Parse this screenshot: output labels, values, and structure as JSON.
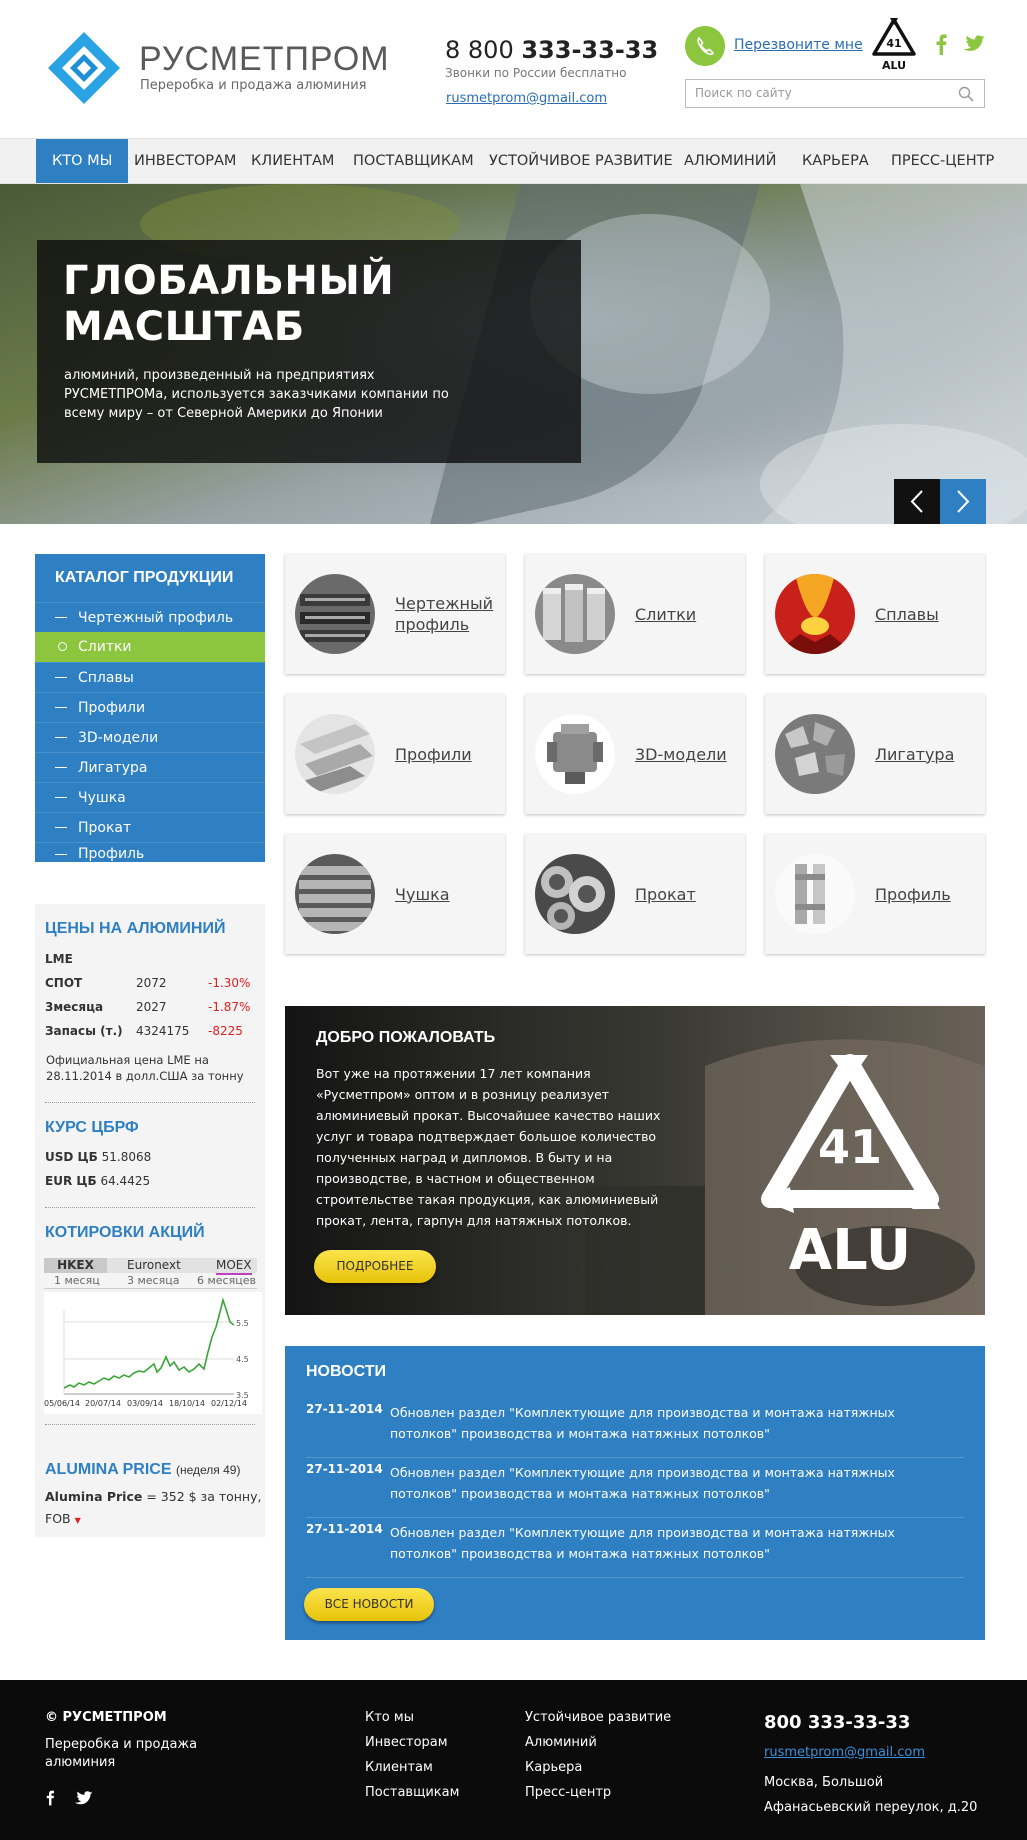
{
  "header": {
    "logo_title": "РУСМЕТПРОМ",
    "logo_subtitle": "Переробка и продажа алюминия",
    "phone_prefix": "8 800",
    "phone_main": "333-33-33",
    "phone_note": "Звонки по России бесплатно",
    "email": "rusmetprom@gmail.com",
    "callback_label": "Перезвоните мне",
    "recycle_number": "41",
    "recycle_label": "ALU",
    "search_placeholder": "Поиск по сайту"
  },
  "nav": {
    "items": [
      "КТО МЫ",
      "ИНВЕСТОРАМ",
      "КЛИЕНТАМ",
      "ПОСТАВЩИКАМ",
      "УСТОЙЧИВОЕ РАЗВИТИЕ",
      "АЛЮМИНИЙ",
      "КАРЬЕРА",
      "ПРЕСС-ЦЕНТР"
    ]
  },
  "hero": {
    "title": "ГЛОБАЛЬНЫЙ МАСШТАБ",
    "text": "алюминий, произведенный на предприятиях РУСМЕТПРОМа, используется заказчиками компании по всему миру – от Северной Америки до Японии"
  },
  "catalog": {
    "title": "КАТАЛОГ ПРОДУКЦИИ",
    "items": [
      "Чертежный профиль",
      "Слитки",
      "Сплавы",
      "Профили",
      "3D-модели",
      "Лигатура",
      "Чушка",
      "Прокат",
      "Профиль"
    ],
    "active_index": 1
  },
  "prices": {
    "title": "ЦЕНЫ НА АЛЮМИНИЙ",
    "lme": "LME",
    "rows": [
      {
        "label": "СПОТ",
        "value": "2072",
        "change": "-1.30%"
      },
      {
        "label": "3месяца",
        "value": "2027",
        "change": "-1.87%"
      },
      {
        "label": "Запасы (т.)",
        "value": "4324175",
        "change": "-8225"
      }
    ],
    "note": "Официальная цена LME на 28.11.2014 в долл.США за тонну"
  },
  "rates": {
    "title": "КУРС ЦБРФ",
    "usd_label": "USD ЦБ",
    "usd_value": "51.8068",
    "eur_label": "EUR ЦБ",
    "eur_value": "64.4425"
  },
  "stocks": {
    "title": "КОТИРОВКИ АКЦИЙ",
    "tabs": [
      "HKEX",
      "Euronext",
      "MOEX"
    ],
    "periods": [
      "1 месяц",
      "3 месяца",
      "6 месяцев"
    ]
  },
  "alumina": {
    "title": "ALUMINA PRICE",
    "week": "(неделя 49)",
    "label": "Alumina Price",
    "value": "= 352 $ за тонну,",
    "basis": "FOB"
  },
  "products": [
    {
      "label": "Чертежный профиль"
    },
    {
      "label": "Слитки"
    },
    {
      "label": "Сплавы"
    },
    {
      "label": "Профили"
    },
    {
      "label": "3D-модели"
    },
    {
      "label": "Лигатура"
    },
    {
      "label": "Чушка"
    },
    {
      "label": "Прокат"
    },
    {
      "label": "Профиль"
    }
  ],
  "welcome": {
    "title": "ДОБРО ПОЖАЛОВАТЬ",
    "text": "Вот уже на протяжении 17 лет компания «Русметпром» оптом и в розницу реализует алюминиевый прокат. Высочайшее качество наших услуг и товара подтверждает большое количество полученных наград и дипломов. В быту и на производстве, в частном и общественном строительстве такая продукция, как алюминиевый прокат, лента, гарпун для натяжных потолков.",
    "button": "ПОДРОБНЕЕ",
    "logo_number": "41",
    "logo_label": "ALU"
  },
  "news": {
    "title": "НОВОСТИ",
    "items": [
      {
        "date": "27-11-2014",
        "text": "Обновлен раздел \"Комплектующие для производства и монтажа натяжных потолков\" производства и монтажа натяжных потолков\""
      },
      {
        "date": "27-11-2014",
        "text": "Обновлен раздел \"Комплектующие для производства и монтажа натяжных потолков\" производства и монтажа натяжных потолков\""
      },
      {
        "date": "27-11-2014",
        "text": "Обновлен раздел \"Комплектующие для производства и монтажа натяжных потолков\" производства и монтажа натяжных потолков\""
      }
    ],
    "button": "ВСЕ НОВОСТИ"
  },
  "footer": {
    "copyright": "© РУСМЕТПРОМ",
    "tagline": "Переробка и продажа алюминия",
    "col1": [
      "Кто мы",
      "Инвесторам",
      "Клиентам",
      "Поставщикам"
    ],
    "col2": [
      "Устойчивое развитие",
      "Алюминий",
      "Карьера",
      "Пресс-центр"
    ],
    "phone": "800 333-33-33",
    "email": "rusmetprom@gmail.com",
    "address": "Москва, Большой Афанасьевский переулок, д.20"
  },
  "colors": {
    "primary": "#2f7fc3",
    "accent_green": "#8cc63f",
    "button_yellow": "#f5d31c",
    "negative": "#e02020",
    "footer_bg": "#0b0b0b"
  }
}
